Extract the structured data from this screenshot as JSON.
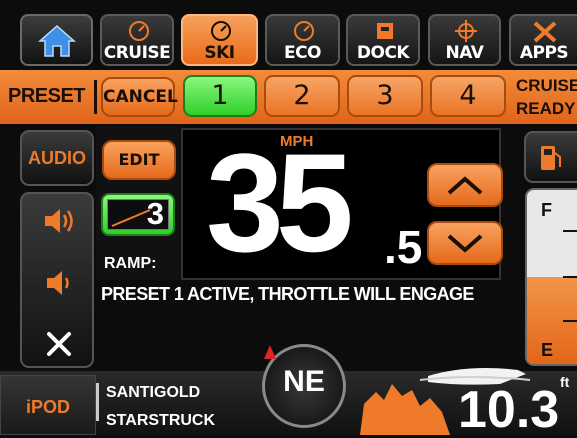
{
  "tabs": [
    {
      "label": "CRUISE",
      "icon": "speedometer-icon"
    },
    {
      "label": "SKI",
      "icon": "speedometer-icon",
      "active": true
    },
    {
      "label": "ECO",
      "icon": "speedometer-icon"
    },
    {
      "label": "DOCK",
      "icon": "dock-icon"
    },
    {
      "label": "NAV",
      "icon": "helm-wheel-icon"
    },
    {
      "label": "APPS",
      "icon": "tools-icon"
    }
  ],
  "home_icon": "home-icon",
  "preset_bar": {
    "title": "PRESET",
    "cancel_label": "CANCEL",
    "presets": [
      "1",
      "2",
      "3",
      "4"
    ],
    "selected_preset": "1",
    "status_line1": "CRUISE",
    "status_line2": "READY"
  },
  "left_panel": {
    "audio_label": "AUDIO",
    "volume_up_icon": "speaker-loud-icon",
    "volume_down_icon": "speaker-soft-icon",
    "mute_icon": "mute-x-icon"
  },
  "controls": {
    "edit_label": "EDIT",
    "ramp_value": "3",
    "ramp_label": "RAMP:"
  },
  "speed": {
    "unit": "MPH",
    "whole": "35",
    "fraction": ".5"
  },
  "message": "PRESET 1 ACTIVE, THROTTLE WILL ENGAGE",
  "fuel": {
    "full_label": "F",
    "empty_label": "E",
    "level_fraction": 0.5,
    "icon": "fuel-pump-icon"
  },
  "media": {
    "source": "iPOD",
    "artist": "SANTIGOLD",
    "track": "STARSTRUCK"
  },
  "compass": {
    "heading": "NE"
  },
  "depth": {
    "unit": "ft",
    "value": "10.3"
  },
  "colors": {
    "accent": "#ee7a2a",
    "selected": "#3fd93a",
    "background": "#0c0c0c"
  }
}
